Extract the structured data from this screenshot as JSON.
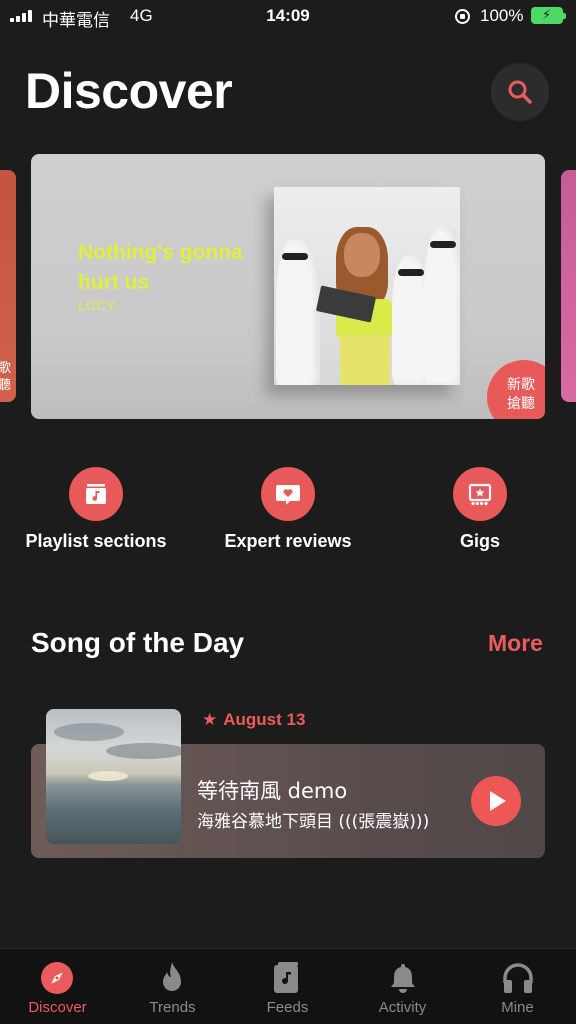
{
  "status_bar": {
    "carrier": "中華電信",
    "network": "4G",
    "time": "14:09",
    "battery": "100%"
  },
  "header": {
    "title": "Discover",
    "search_icon": "search-icon"
  },
  "banner": {
    "title": "Nothing's gonna hurt us",
    "artist": "LÜCY",
    "badge": "新歌搶聽",
    "peek_left_text": "歌聽"
  },
  "actions": [
    {
      "label": "Playlist sections",
      "icon": "playlist-icon"
    },
    {
      "label": "Expert reviews",
      "icon": "review-heart-icon"
    },
    {
      "label": "Gigs",
      "icon": "ticket-icon"
    }
  ],
  "song_of_the_day": {
    "section_title": "Song of the Day",
    "more_label": "More",
    "date": "August 13",
    "title": "等待南風 demo",
    "artist": "海雅谷慕地下頭目 (((張震嶽)))"
  },
  "tabs": [
    {
      "label": "Discover",
      "icon": "compass-icon",
      "active": true
    },
    {
      "label": "Trends",
      "icon": "flame-icon",
      "active": false
    },
    {
      "label": "Feeds",
      "icon": "feeds-icon",
      "active": false
    },
    {
      "label": "Activity",
      "icon": "bell-icon",
      "active": false
    },
    {
      "label": "Mine",
      "icon": "headphones-icon",
      "active": false
    }
  ],
  "colors": {
    "background": "#1c1c1c",
    "accent": "#ec5b5b",
    "banner_text": "#e2ef3b",
    "tab_inactive": "#8a8a8a"
  }
}
